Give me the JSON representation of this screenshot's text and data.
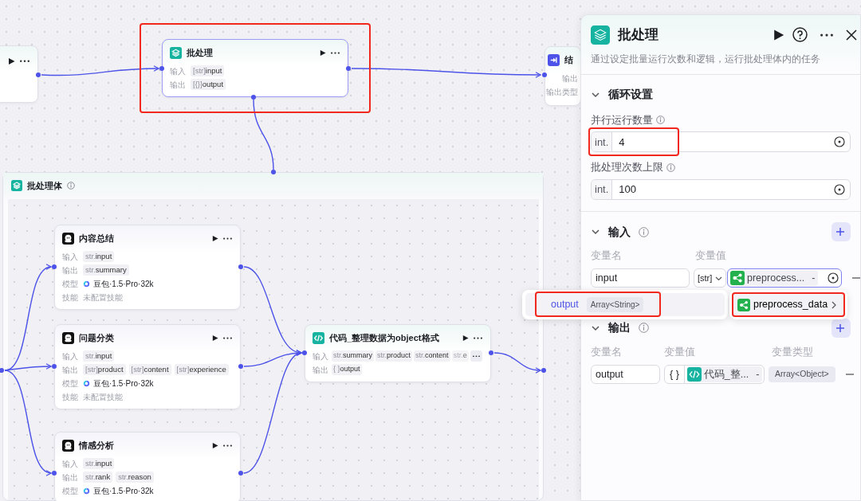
{
  "canvas": {
    "nodes": [
      {
        "kind": "batch",
        "title": "批处理",
        "highlighted": true,
        "rows": [
          {
            "label": "输入",
            "tags": [
              {
                "type": "[str]",
                "name": "input"
              }
            ]
          },
          {
            "label": "输出",
            "tags": [
              {
                "type": "[{}]",
                "name": "output"
              }
            ]
          }
        ]
      },
      {
        "kind": "end",
        "title": "结",
        "highlighted": false,
        "rows": [
          {
            "label": "输出"
          },
          {
            "label": "输出类型"
          }
        ]
      }
    ],
    "group": {
      "title": "批处理体",
      "nodes": [
        {
          "kind": "llm",
          "title": "内容总结",
          "highlighted": false,
          "rows": [
            {
              "label": "输入",
              "tags": [
                {
                  "type": "str.",
                  "name": "input"
                }
              ]
            },
            {
              "label": "输出",
              "tags": [
                {
                  "type": "str.",
                  "name": "summary"
                }
              ]
            },
            {
              "label": "模型",
              "model": "豆包·1.5·Pro·32k"
            },
            {
              "label": "技能",
              "note": "未配置技能"
            }
          ]
        },
        {
          "kind": "llm",
          "title": "问题分类",
          "highlighted": false,
          "rows": [
            {
              "label": "输入",
              "tags": [
                {
                  "type": "str.",
                  "name": "input"
                }
              ]
            },
            {
              "label": "输出",
              "tags": [
                {
                  "type": "[str]",
                  "name": "product"
                },
                {
                  "type": "[str]",
                  "name": "content"
                },
                {
                  "type": "[str]",
                  "name": "experience"
                }
              ]
            },
            {
              "label": "模型",
              "model": "豆包·1.5·Pro·32k"
            },
            {
              "label": "技能",
              "note": "未配置技能"
            }
          ]
        },
        {
          "kind": "llm",
          "title": "情感分析",
          "highlighted": false,
          "rows": [
            {
              "label": "输入",
              "tags": [
                {
                  "type": "str.",
                  "name": "input"
                }
              ]
            },
            {
              "label": "输出",
              "tags": [
                {
                  "type": "str.",
                  "name": "rank"
                },
                {
                  "type": "str.",
                  "name": "reason"
                }
              ]
            },
            {
              "label": "模型",
              "model": "豆包·1.5·Pro·32k"
            }
          ]
        },
        {
          "kind": "code",
          "title": "代码_整理数据为object格式",
          "highlighted": false,
          "rows": [
            {
              "label": "输入",
              "tags": [
                {
                  "type": "str.",
                  "name": "summary"
                },
                {
                  "type": "str.",
                  "name": "product"
                },
                {
                  "type": "str.",
                  "name": "content"
                },
                {
                  "type": "str.",
                  "name": "e",
                  "faded": true
                }
              ],
              "more": true
            },
            {
              "label": "输出",
              "tags": [
                {
                  "type": "{ }",
                  "name": "output"
                }
              ]
            }
          ]
        }
      ]
    }
  },
  "panel": {
    "title": "批处理",
    "description": "通过设定批量运行次数和逻辑，运行批处理体内的任务",
    "loop_section": {
      "title": "循环设置",
      "expanded": true,
      "fields": [
        {
          "label": "并行运行数量",
          "type": "int.",
          "value": "4",
          "highlighted": true
        },
        {
          "label": "批处理次数上限",
          "type": "int.",
          "value": "100",
          "highlighted": false
        }
      ]
    },
    "input_section": {
      "title": "输入",
      "expanded": true,
      "columns": [
        "变量名",
        "变量值"
      ],
      "rows": [
        {
          "name": "input",
          "type": "[str]",
          "ref": "preprocess...",
          "ref_suffix": "-"
        }
      ]
    },
    "output_section": {
      "title": "输出",
      "expanded": true,
      "columns": [
        "变量名",
        "变量值",
        "变量类型"
      ],
      "rows": [
        {
          "name": "output",
          "type": "{ }",
          "ref": "代码_整...",
          "ref_suffix": "-",
          "var_type": "Array<Object>"
        }
      ]
    }
  },
  "popup": {
    "items": [
      {
        "name": "output",
        "type": "Array<String>",
        "highlighted": true
      }
    ],
    "sources": [
      {
        "name": "preprocess_data",
        "highlighted": true
      }
    ]
  }
}
